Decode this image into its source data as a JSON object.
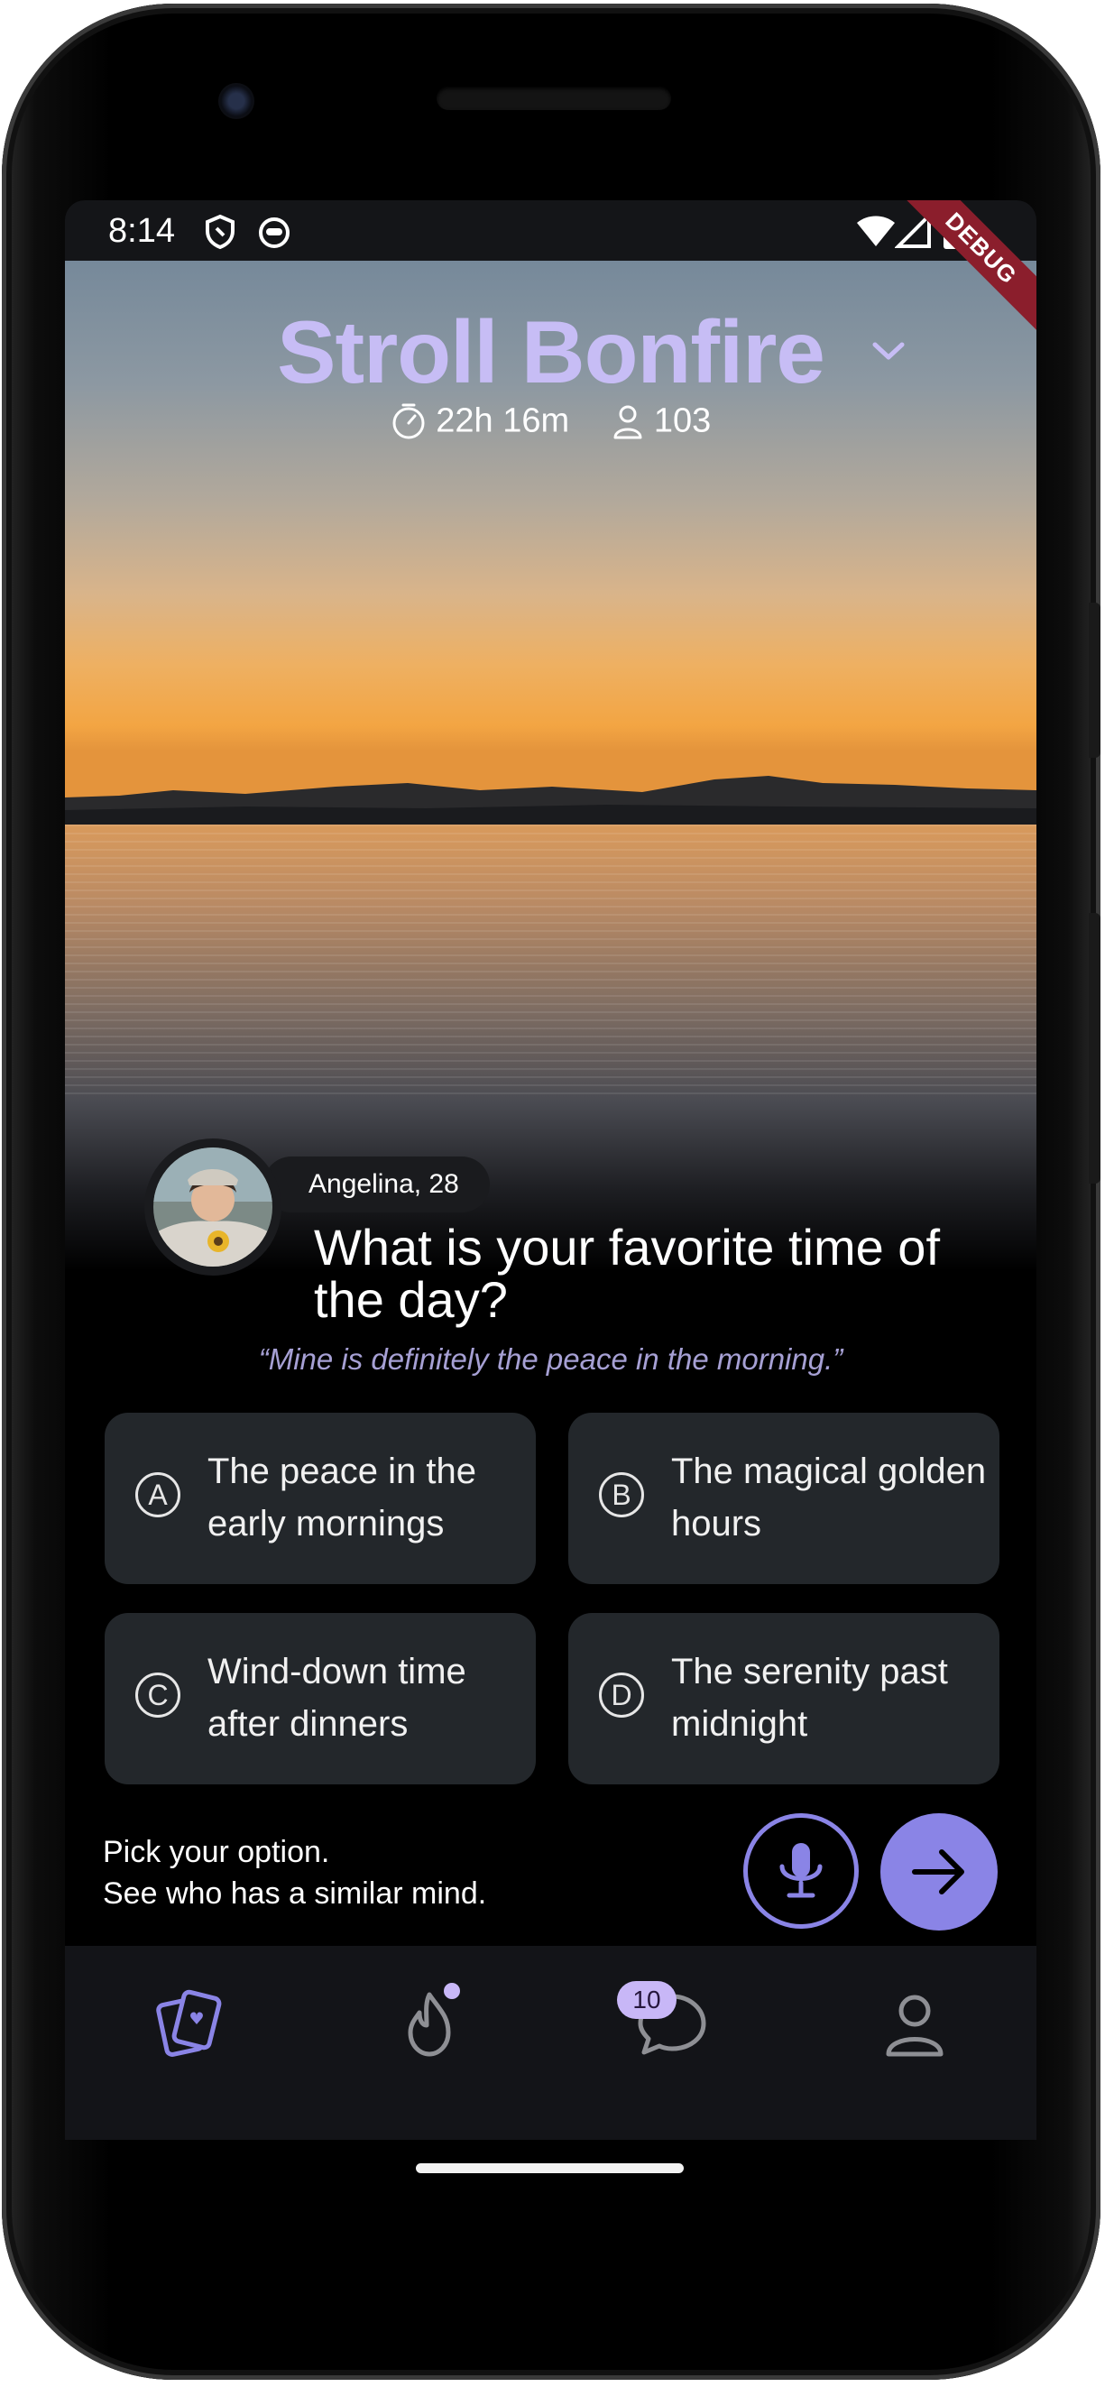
{
  "status_bar": {
    "time": "8:14",
    "icons": [
      "shield-icon",
      "app-icon",
      "wifi-icon",
      "signal-icon",
      "battery-icon"
    ],
    "debug_label": "DEBUG"
  },
  "header": {
    "title": "Stroll Bonfire",
    "timer": "22h 16m",
    "participants": "103",
    "title_color": "#c7bdf5"
  },
  "card": {
    "author": "Angelina, 28",
    "question": "What is your favorite time of the day?",
    "quote": "“Mine is definitely the peace in the morning.”"
  },
  "options": [
    {
      "letter": "A",
      "text": "The peace in the early mornings"
    },
    {
      "letter": "B",
      "text": "The magical golden hours"
    },
    {
      "letter": "C",
      "text": "Wind-down time after dinners"
    },
    {
      "letter": "D",
      "text": "The serenity past midnight"
    }
  ],
  "footer": {
    "hint_line1": "Pick your option.",
    "hint_line2": "See who has a similar mind."
  },
  "nav": {
    "items": [
      {
        "icon": "cards-icon",
        "active": true
      },
      {
        "icon": "flame-icon",
        "active": false
      },
      {
        "icon": "chat-icon",
        "active": false
      },
      {
        "icon": "profile-icon",
        "active": false
      }
    ],
    "chat_badge": "10"
  },
  "colors": {
    "accent": "#8a84e6",
    "badge": "#c8b7f7",
    "option_bg": "#23272b",
    "nav_bg": "#131418"
  }
}
